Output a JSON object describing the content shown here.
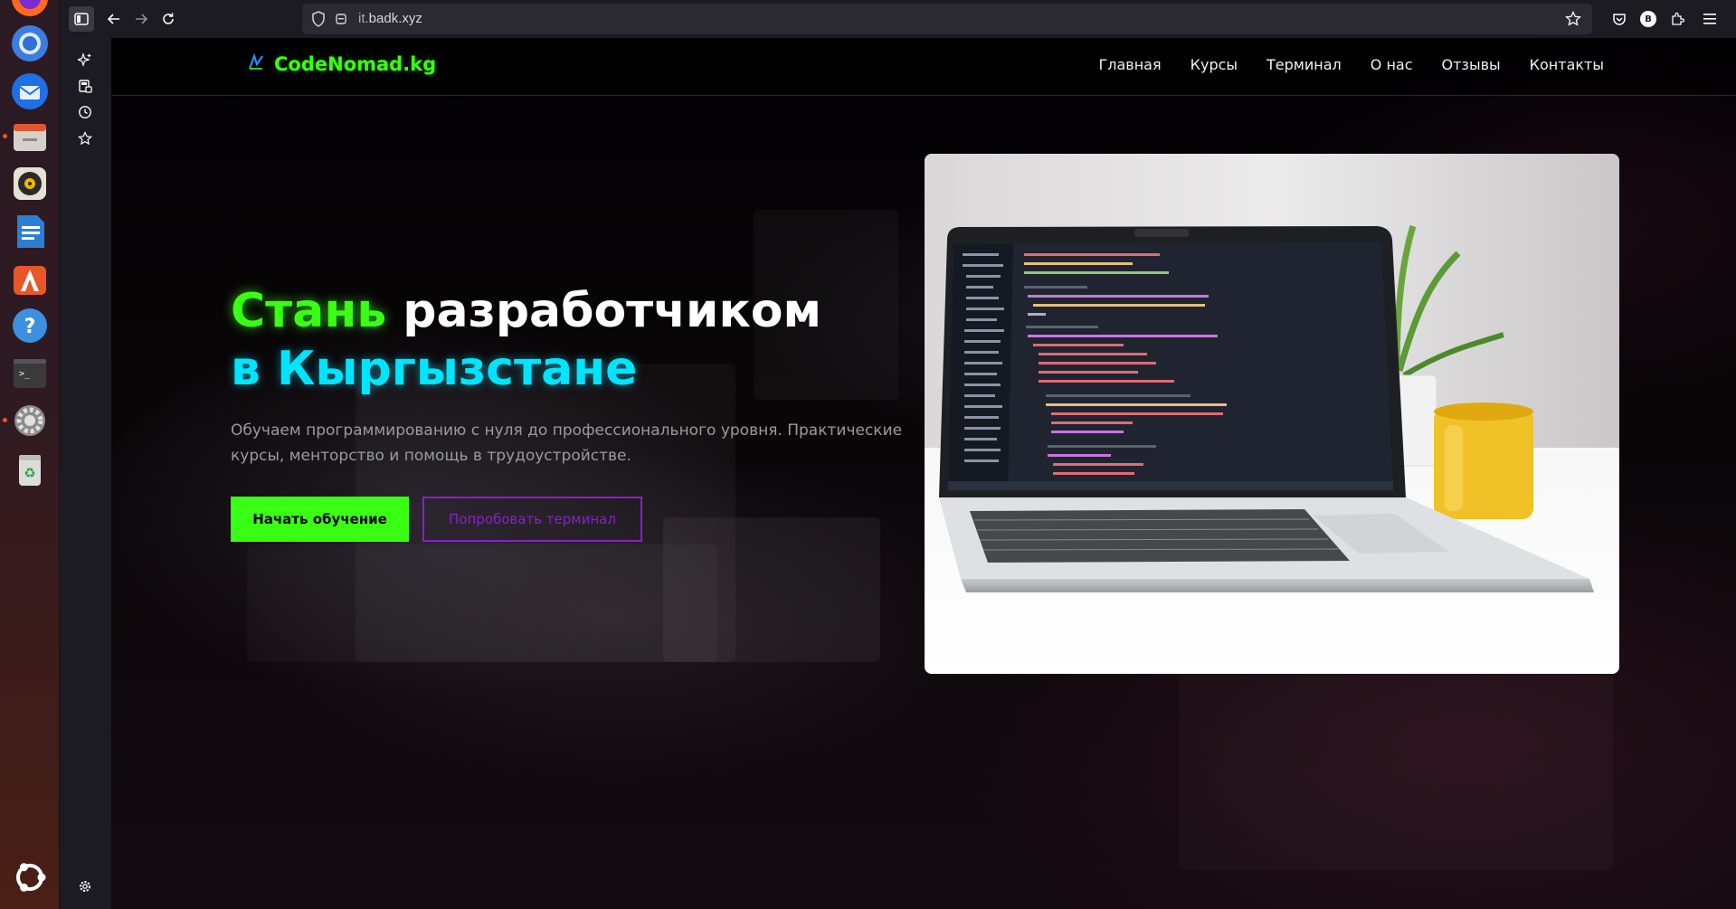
{
  "browser": {
    "url_host": "it.",
    "url_domain": "badk.xyz",
    "account_initial": "B"
  },
  "site": {
    "brand": "CodeNomad.kg",
    "nav": [
      "Главная",
      "Курсы",
      "Терминал",
      "О нас",
      "Отзывы",
      "Контакты"
    ]
  },
  "hero": {
    "title_word_1": "Стань",
    "title_word_2": " разработчиком",
    "title_line_2": "в Кыргызстане",
    "subtitle": "Обучаем программированию с нуля до профессионального уровня. Практические курсы, менторство и помощь в трудоустройстве.",
    "primary_button": "Начать обучение",
    "secondary_button": "Попробовать терминал"
  },
  "colors": {
    "accent_green": "#39ff14",
    "accent_cyan": "#00e5ff",
    "accent_purple": "#8a1ecf"
  },
  "dock_icons": [
    "firefox-icon",
    "chromium-icon",
    "thunderbird-icon",
    "files-icon",
    "rhythmbox-icon",
    "writer-icon",
    "app-center-icon",
    "help-icon",
    "terminal-icon",
    "settings-icon",
    "trash-icon",
    "ubuntu-logo-icon"
  ]
}
